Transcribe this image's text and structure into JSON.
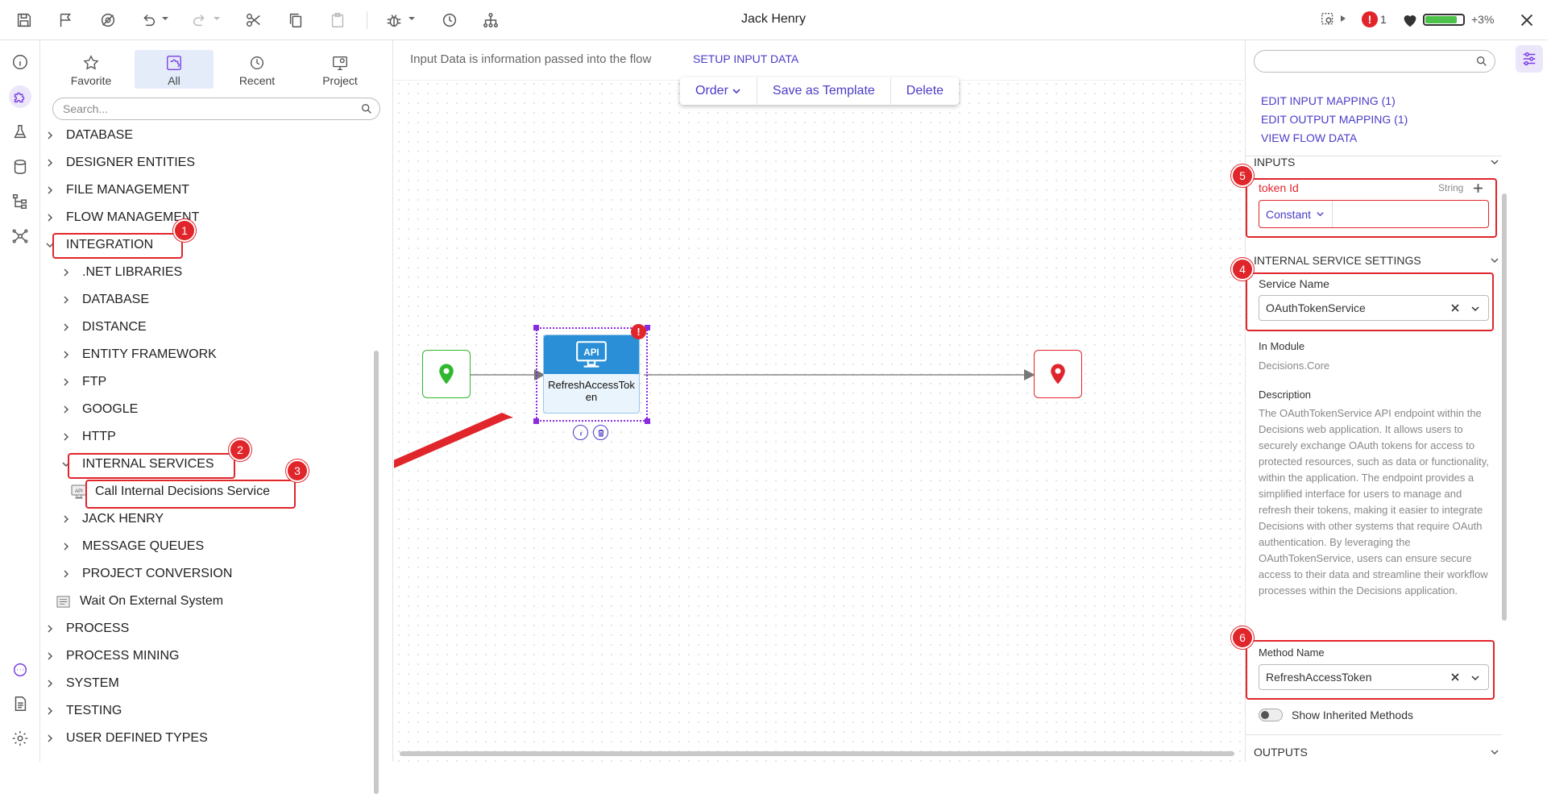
{
  "app": {
    "title": "Jack Henry"
  },
  "toolbar": {
    "error_count": "1",
    "health_pct": "+3%",
    "health_level": 0.85,
    "error_glyph": "!"
  },
  "toolbox": {
    "tabs": [
      {
        "label": "Favorite",
        "icon": "star-icon"
      },
      {
        "label": "All",
        "icon": "puzzle-icon",
        "active": true
      },
      {
        "label": "Recent",
        "icon": "clock-icon"
      },
      {
        "label": "Project",
        "icon": "project-icon"
      }
    ],
    "search_placeholder": "Search...",
    "tree": [
      {
        "label": "DATABASE"
      },
      {
        "label": "DESIGNER ENTITIES"
      },
      {
        "label": "FILE MANAGEMENT"
      },
      {
        "label": "FLOW MANAGEMENT"
      },
      {
        "label": "INTEGRATION"
      },
      {
        "label": ".NET LIBRARIES"
      },
      {
        "label": "DATABASE"
      },
      {
        "label": "DISTANCE"
      },
      {
        "label": "ENTITY FRAMEWORK"
      },
      {
        "label": "FTP"
      },
      {
        "label": "GOOGLE"
      },
      {
        "label": "HTTP"
      },
      {
        "label": "INTERNAL SERVICES"
      },
      {
        "label": "Call Internal Decisions Service"
      },
      {
        "label": "JACK HENRY"
      },
      {
        "label": "MESSAGE QUEUES"
      },
      {
        "label": "PROJECT CONVERSION"
      },
      {
        "label": "Wait On External System"
      },
      {
        "label": "PROCESS"
      },
      {
        "label": "PROCESS MINING"
      },
      {
        "label": "SYSTEM"
      },
      {
        "label": "TESTING"
      },
      {
        "label": "USER DEFINED TYPES"
      }
    ]
  },
  "canvas": {
    "info_text": "Input Data is information passed into the flow",
    "setup_link": "SETUP INPUT DATA",
    "actions": {
      "order": "Order",
      "save_template": "Save as Template",
      "delete": "Delete"
    },
    "step": {
      "name": "RefreshAccessToken",
      "icon_text": "API",
      "error_glyph": "!"
    }
  },
  "annotations": [
    "1",
    "2",
    "3",
    "4",
    "5",
    "6"
  ],
  "properties": {
    "links": [
      "EDIT INPUT MAPPING (1)",
      "EDIT OUTPUT MAPPING (1)",
      "VIEW FLOW DATA"
    ],
    "inputs_header": "INPUTS",
    "token_label": "token Id",
    "token_type": "String",
    "token_mode": "Constant",
    "token_value": "",
    "service_settings_header": "INTERNAL SERVICE SETTINGS",
    "service_name_label": "Service Name",
    "service_name_value": "OAuthTokenService",
    "in_module_label": "In Module",
    "in_module_value": "Decisions.Core",
    "description_label": "Description",
    "description": "The OAuthTokenService API endpoint within the Decisions web application. It allows users to securely exchange OAuth tokens for access to protected resources, such as data or functionality, within the application. The endpoint provides a simplified interface for users to manage and refresh their tokens, making it easier to integrate Decisions with other systems that require OAuth authentication. By leveraging the OAuthTokenService, users can ensure secure access to their data and streamline their workflow processes within the Decisions application.",
    "method_name_label": "Method Name",
    "method_name_value": "RefreshAccessToken",
    "show_inherited_label": "Show Inherited Methods",
    "outputs_header": "OUTPUTS"
  },
  "colors": {
    "accent": "#4a3cc8",
    "annotation": "#e0252b",
    "step_blue": "#2a8fd6",
    "start_green": "#2fb82f",
    "end_red": "#e0252b"
  }
}
